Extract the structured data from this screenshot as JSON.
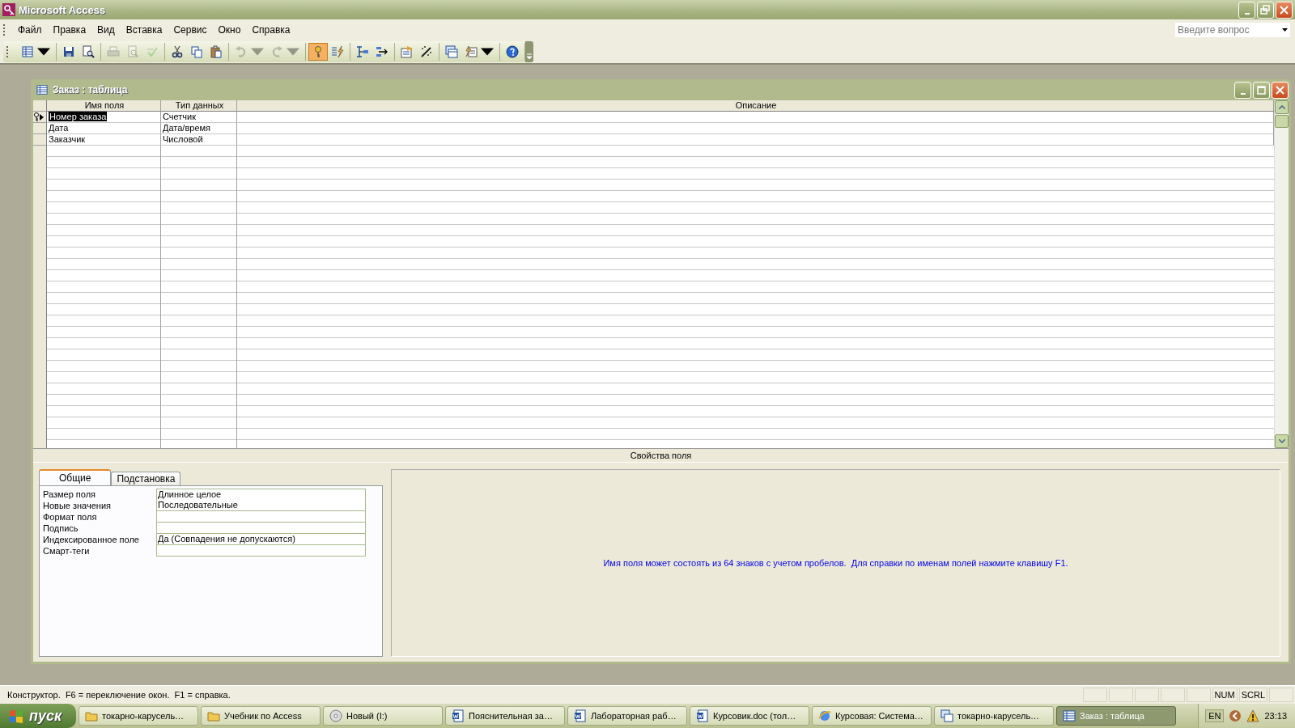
{
  "window": {
    "title": "Microsoft Access"
  },
  "menu": [
    {
      "label": "Файл"
    },
    {
      "label": "Правка"
    },
    {
      "label": "Вид"
    },
    {
      "label": "Вставка"
    },
    {
      "label": "Сервис"
    },
    {
      "label": "Окно"
    },
    {
      "label": "Справка"
    }
  ],
  "help_search": {
    "placeholder": "Введите вопрос"
  },
  "toolbar": [
    [
      {
        "dropdown": true,
        "disabled": false,
        "on": false
      }
    ],
    [
      {
        "dropdown": false,
        "disabled": false,
        "on": false
      },
      {
        "dropdown": false,
        "disabled": false,
        "on": false
      }
    ],
    [
      {
        "dropdown": false,
        "disabled": true,
        "on": false
      },
      {
        "dropdown": false,
        "disabled": true,
        "on": false
      },
      {
        "dropdown": false,
        "disabled": true,
        "on": false
      }
    ],
    [
      {
        "dropdown": false,
        "disabled": false,
        "on": false
      },
      {
        "dropdown": false,
        "disabled": false,
        "on": false
      },
      {
        "dropdown": false,
        "disabled": false,
        "on": false
      }
    ],
    [
      {
        "dropdown": true,
        "disabled": true,
        "on": false
      },
      {
        "dropdown": true,
        "disabled": true,
        "on": false
      }
    ],
    [
      {
        "dropdown": false,
        "disabled": false,
        "on": true
      },
      {
        "dropdown": false,
        "disabled": false,
        "on": false
      }
    ],
    [
      {
        "dropdown": false,
        "disabled": false,
        "on": false
      },
      {
        "dropdown": false,
        "disabled": false,
        "on": false
      }
    ],
    [
      {
        "dropdown": false,
        "disabled": false,
        "on": false
      },
      {
        "dropdown": false,
        "disabled": false,
        "on": false
      }
    ],
    [
      {
        "dropdown": false,
        "disabled": false,
        "on": false
      },
      {
        "dropdown": true,
        "disabled": false,
        "on": false
      }
    ],
    [
      {
        "dropdown": false,
        "disabled": false,
        "on": false
      }
    ]
  ],
  "document": {
    "title": "Заказ : таблица",
    "columns": [
      "Имя поля",
      "Тип данных",
      "Описание"
    ],
    "rows": [
      {
        "name": "Номер заказа",
        "type": "Счетчик",
        "primary_key": true,
        "selected": true
      },
      {
        "name": "Дата",
        "type": "Дата/время",
        "primary_key": false,
        "selected": false
      },
      {
        "name": "Заказчик",
        "type": "Числовой",
        "primary_key": false,
        "selected": false
      }
    ],
    "section_label": "Свойства поля",
    "tabs": [
      {
        "label": "Общие",
        "selected": true
      },
      {
        "label": "Подстановка",
        "selected": false
      }
    ],
    "properties": [
      {
        "label": "Размер поля",
        "value": "Длинное целое"
      },
      {
        "label": "Новые значения",
        "value": "Последовательные"
      },
      {
        "label": "Формат поля"
      },
      {
        "label": "Подпись"
      },
      {
        "label": "Индексированное поле",
        "value": "Да (Совпадения не допускаются)"
      },
      {
        "label": "Смарт-теги"
      }
    ],
    "help_text": "Имя поля может состоять из 64 знаков с учетом пробелов.  Для справки по именам полей нажмите клавишу F1."
  },
  "status_bar": {
    "text": "Конструктор.  F6 = переключение окон.  F1 = справка.",
    "indicators": [
      "NUM",
      "SCRL"
    ]
  },
  "taskbar": {
    "start": "пуск",
    "tasks": [
      {
        "kind": "folder",
        "label": "токарно-карусель…",
        "selected": false
      },
      {
        "kind": "folder",
        "label": "Учебник по Access",
        "selected": false
      },
      {
        "kind": "disc",
        "label": "Новый (I:)",
        "selected": false
      },
      {
        "kind": "word",
        "label": "Пояснительная за…",
        "selected": false
      },
      {
        "kind": "word",
        "label": "Лабораторная раб…",
        "selected": false
      },
      {
        "kind": "word",
        "label": "Курсовик.doc (тол…",
        "selected": false
      },
      {
        "kind": "browser",
        "label": "Курсовая: Система…",
        "selected": false
      },
      {
        "kind": "database",
        "label": "токарно-карусель…",
        "selected": false
      },
      {
        "kind": "table",
        "label": "Заказ : таблица",
        "selected": true
      }
    ],
    "language": "EN",
    "clock": "23:13"
  }
}
